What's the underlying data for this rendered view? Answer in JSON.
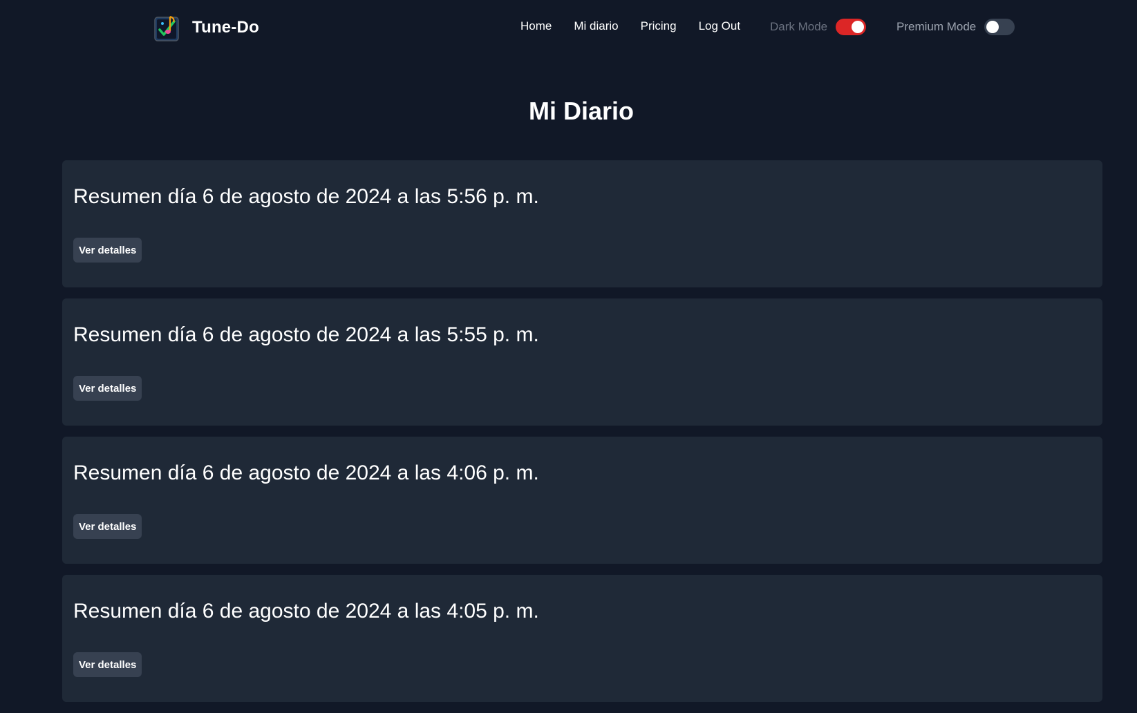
{
  "brand": {
    "name": "Tune-Do",
    "logo_icon": "music-checklist-logo-icon"
  },
  "nav": {
    "links": [
      {
        "label": "Home"
      },
      {
        "label": "Mi diario"
      },
      {
        "label": "Pricing"
      },
      {
        "label": "Log Out"
      }
    ],
    "dark_mode": {
      "label": "Dark Mode",
      "on": true,
      "color": "#dc2626"
    },
    "premium_mode": {
      "label": "Premium Mode",
      "on": false,
      "color": "#374151"
    }
  },
  "page": {
    "title": "Mi Diario"
  },
  "entries": [
    {
      "title": "Resumen día 6 de agosto de 2024 a las 5:56 p. m.",
      "button": "Ver detalles"
    },
    {
      "title": "Resumen día 6 de agosto de 2024 a las 5:55 p. m.",
      "button": "Ver detalles"
    },
    {
      "title": "Resumen día 6 de agosto de 2024 a las 4:06 p. m.",
      "button": "Ver detalles"
    },
    {
      "title": "Resumen día 6 de agosto de 2024 a las 4:05 p. m.",
      "button": "Ver detalles"
    }
  ],
  "colors": {
    "background": "#111827",
    "card": "#1f2937",
    "button": "#374151",
    "accent": "#dc2626"
  }
}
